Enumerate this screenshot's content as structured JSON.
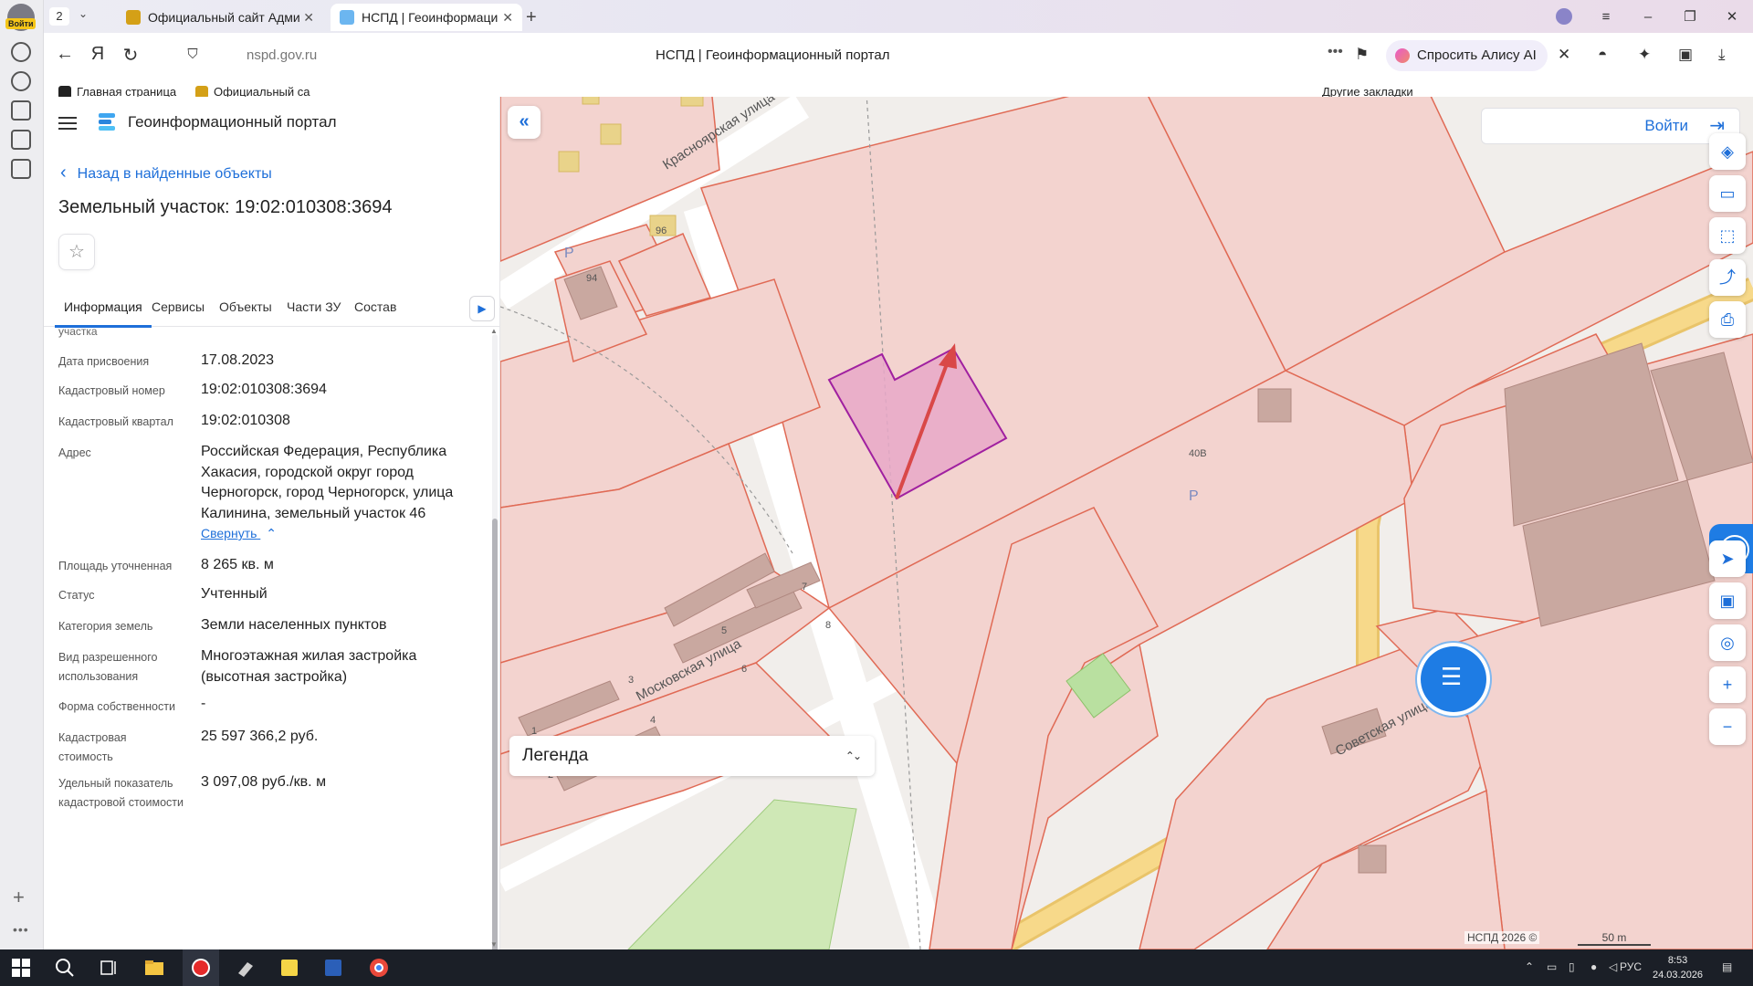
{
  "browser": {
    "tab_count": "2",
    "tabs": [
      {
        "title": "Официальный сайт Адми"
      },
      {
        "title": "НСПД | Геоинформаци"
      }
    ],
    "url": "nspd.gov.ru",
    "page_title": "НСПД | Геоинформационный портал",
    "alice_label": "Спросить Алису AI",
    "profile_badge": "Войти",
    "bookmarks": [
      {
        "label": "Главная страница"
      },
      {
        "label": "Официальный са"
      }
    ],
    "other_bookmarks": "Другие закладки"
  },
  "portal": {
    "name": "Геоинформационный портал",
    "back_link": "Назад в найденные объекты",
    "object_title": "Земельный участок: 19:02:010308:3694",
    "tabs": [
      "Информация",
      "Сервисы",
      "Объекты",
      "Части ЗУ",
      "Состав"
    ],
    "truncated_label": "участка",
    "rows": [
      {
        "label": "Дата присвоения",
        "value": "17.08.2023"
      },
      {
        "label": "Кадастровый номер",
        "value": "19:02:010308:3694"
      },
      {
        "label": "Кадастровый квартал",
        "value": "19:02:010308"
      },
      {
        "label": "Адрес",
        "value": "Российская Федерация, Республика Хакасия, городской округ город Черногорск, город Черногорск, улица Калинина, земельный участок 46"
      },
      {
        "label": "Площадь уточненная",
        "value": "8 265 кв. м"
      },
      {
        "label": "Статус",
        "value": "Учтенный"
      },
      {
        "label": "Категория земель",
        "value": "Земли населенных пунктов"
      },
      {
        "label": "Вид разрешенного использования",
        "value": "Многоэтажная жилая застройка (высотная застройка)"
      },
      {
        "label": "Форма собственности",
        "value": "-"
      },
      {
        "label": "Кадастровая стоимость",
        "value": "25 597 366,2 руб."
      },
      {
        "label": "Удельный показатель кадастровой стоимости",
        "value": "3 097,08 руб./кв. м"
      }
    ],
    "collapse_label": "Свернуть"
  },
  "map": {
    "login_label": "Войти",
    "legend_label": "Легенда",
    "copyright": "НСПД 2026 ©",
    "scale": "50 m",
    "streets": [
      "Красноярская улица",
      "Московская улица",
      "Советская улица"
    ],
    "house_numbers": [
      "96",
      "94",
      "7",
      "5",
      "8",
      "3",
      "6",
      "4",
      "1",
      "2",
      "40В"
    ],
    "parking_label": "P",
    "colors": {
      "parcel_fill": "#f3d3cf",
      "parcel_stroke": "#e06a55",
      "selected_fill": "#e8a8c8",
      "selected_stroke": "#a020a0",
      "road": "#f7d98a",
      "building": "#c9a8a0",
      "accent": "#1e6fd9",
      "arrow": "#d94848"
    }
  },
  "taskbar": {
    "lang": "РУС",
    "time": "8:53",
    "date": "24.03.2026"
  }
}
